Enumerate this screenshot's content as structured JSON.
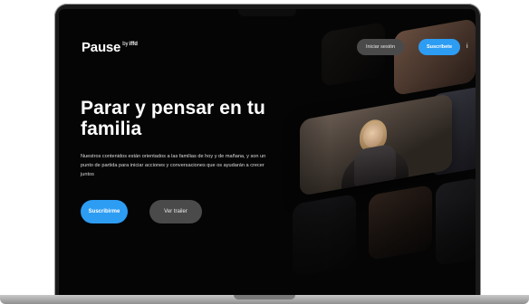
{
  "header": {
    "logo": "Pause",
    "logo_by": "by",
    "logo_brand": "iffd",
    "login_label": "Iniciar sesión",
    "subscribe_label": "Suscríbete",
    "menu_glyph": "i"
  },
  "hero": {
    "title": "Parar y pensar en tu familia",
    "description": "Nuestros contenidos están orientados a las familias de hoy y de mañana, y son un punto de partida para iniciar acciones y conversaciones que os ayudarán a crecer juntos",
    "primary_cta": "Suscribirme",
    "secondary_cta": "Ver trailer"
  },
  "colors": {
    "accent": "#2d9cf3",
    "background": "#050505",
    "secondary_button": "#4a4a4a"
  }
}
